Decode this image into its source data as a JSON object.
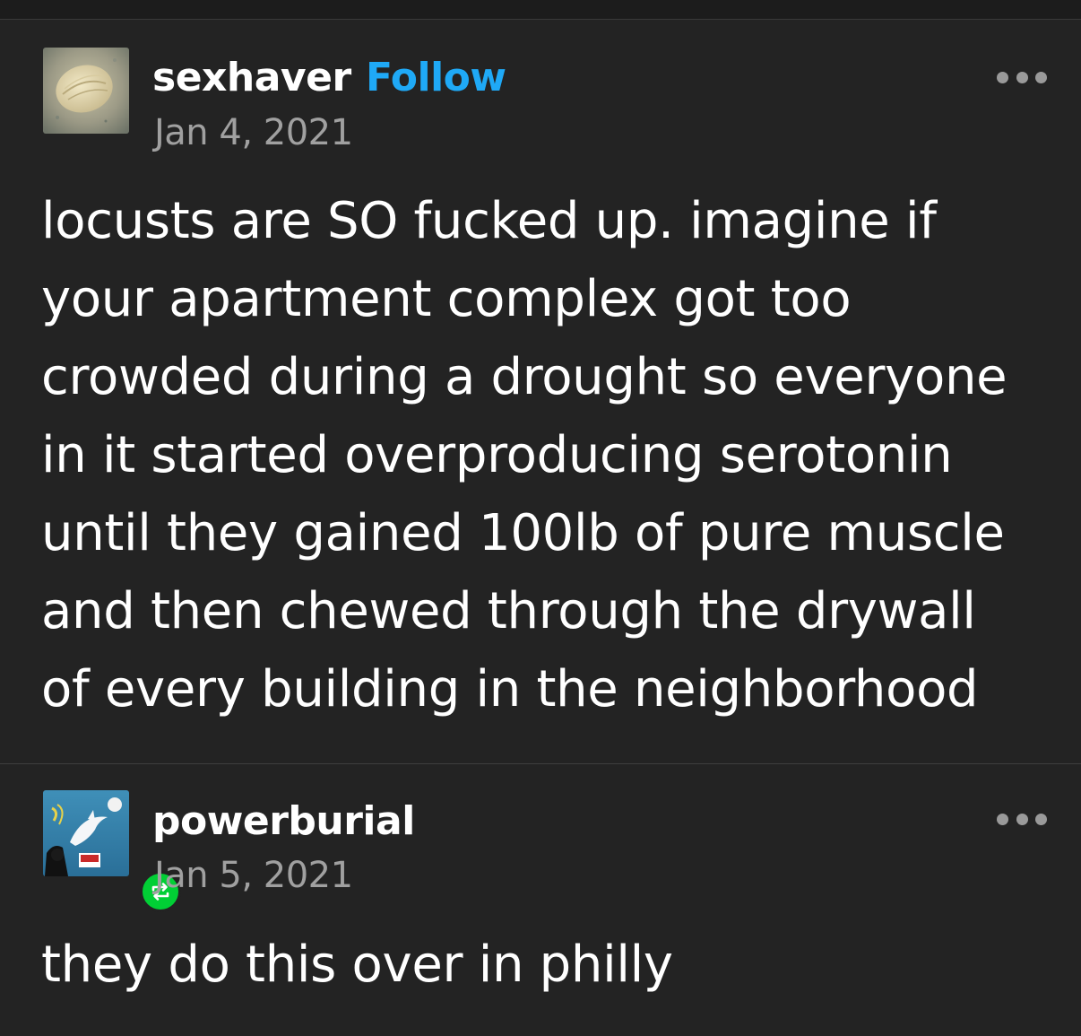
{
  "posts": [
    {
      "username": "sexhaver",
      "follow_label": "Follow",
      "date": "Jan 4, 2021",
      "avatar_icon": "avatar-sand-dollar",
      "lines": [
        "locusts are SO fucked up. imagine if",
        "your apartment complex got too",
        "crowded during a drought so everyone",
        "in it started overproducing serotonin",
        "until they gained 100lb of pure muscle",
        "and then chewed through the drywall",
        "of every building in the neighborhood"
      ]
    },
    {
      "username": "powerburial",
      "date": "Jan 5, 2021",
      "avatar_icon": "avatar-dolphin-collage",
      "badge_icon": "reblog-icon",
      "lines": [
        "they do this over in philly"
      ]
    }
  ],
  "colors": {
    "background": "#232323",
    "follow": "#1fa9f6",
    "date": "#a0a0a0",
    "reblog_badge": "#01cf35",
    "more_dots": "#9a9a9a"
  },
  "icons": {
    "more": "more-options-icon"
  }
}
